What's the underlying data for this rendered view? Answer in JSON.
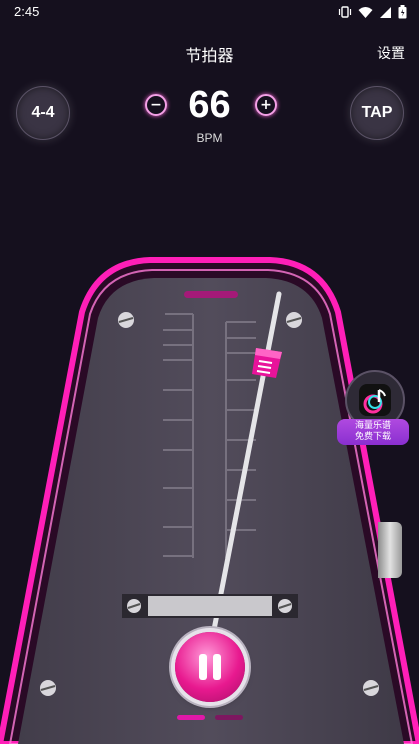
{
  "status_bar": {
    "time": "2:45"
  },
  "header": {
    "title": "节拍器",
    "settings_label": "设置"
  },
  "controls": {
    "time_signature": "4-4",
    "bpm_value": "66",
    "bpm_unit": "BPM",
    "tap_label": "TAP",
    "minus_symbol": "−",
    "plus_symbol": "+"
  },
  "promo": {
    "line1": "海量乐谱",
    "line2": "免费下载"
  },
  "player": {
    "state": "playing",
    "page_count": 2,
    "active_page": 1
  },
  "colors": {
    "accent": "#e018a8",
    "background": "#15101e",
    "body": "#4a4552"
  }
}
